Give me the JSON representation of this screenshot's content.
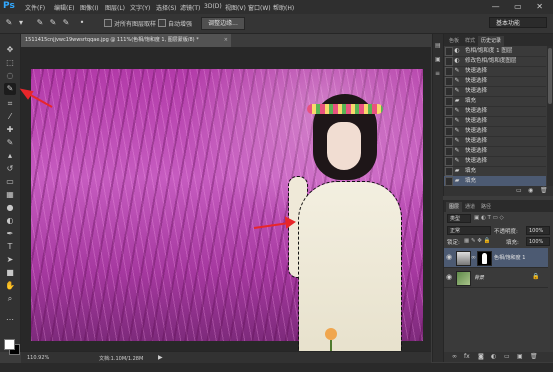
{
  "app": {
    "logo": "Ps"
  },
  "menubar": {
    "items": [
      "文件(F)",
      "编辑(E)",
      "图像(I)",
      "图层(L)",
      "文字(Y)",
      "选择(S)",
      "滤镜(T)",
      "3D(D)",
      "视图(V)",
      "窗口(W)",
      "帮助(H)"
    ],
    "window_controls": "— ▭ ✕"
  },
  "options": {
    "sample_all_layers": "对所有图层取样",
    "auto_enhance": "自动增强",
    "refine_edge": "调整边缘...",
    "workspace": "基本功能"
  },
  "document": {
    "tab_title": "1511415cnjjvwc19wwsrtqqae.jpg @ 111%(色相/饱和度 1, 图层蒙版/8) *",
    "zoom": "110.92%",
    "doc_size": "文档:1.10M/1.28M"
  },
  "history": {
    "tabs": [
      "色板",
      "样式",
      "历史记录"
    ],
    "items": [
      {
        "label": "色相/饱和度 1 图层",
        "icon": "adjustment-icon"
      },
      {
        "label": "修改色相/饱和度图层",
        "icon": "adjustment-icon"
      },
      {
        "label": "快速选择",
        "icon": "brush-icon"
      },
      {
        "label": "快速选择",
        "icon": "brush-icon"
      },
      {
        "label": "快速选择",
        "icon": "brush-icon"
      },
      {
        "label": "填充",
        "icon": "fill-icon"
      },
      {
        "label": "快速选择",
        "icon": "brush-icon"
      },
      {
        "label": "快速选择",
        "icon": "brush-icon"
      },
      {
        "label": "快速选择",
        "icon": "brush-icon"
      },
      {
        "label": "快速选择",
        "icon": "brush-icon"
      },
      {
        "label": "快速选择",
        "icon": "brush-icon"
      },
      {
        "label": "快速选择",
        "icon": "brush-icon"
      },
      {
        "label": "填充",
        "icon": "fill-icon"
      },
      {
        "label": "填充",
        "icon": "fill-icon"
      }
    ],
    "selected_index": 13
  },
  "layers": {
    "tabs": [
      "图层",
      "通道",
      "路径"
    ],
    "filter_kind": "类型",
    "blend_mode": "正常",
    "opacity_label": "不透明度:",
    "opacity_value": "100%",
    "lock_label": "锁定:",
    "fill_label": "填充:",
    "fill_value": "100%",
    "items": [
      {
        "name": "色相/饱和度 1",
        "selected": true
      },
      {
        "name": "背景",
        "selected": false
      }
    ]
  },
  "colors": {
    "accent": "#31a8ff",
    "selection": "#4c5a72",
    "arrow": "#e8262a"
  }
}
